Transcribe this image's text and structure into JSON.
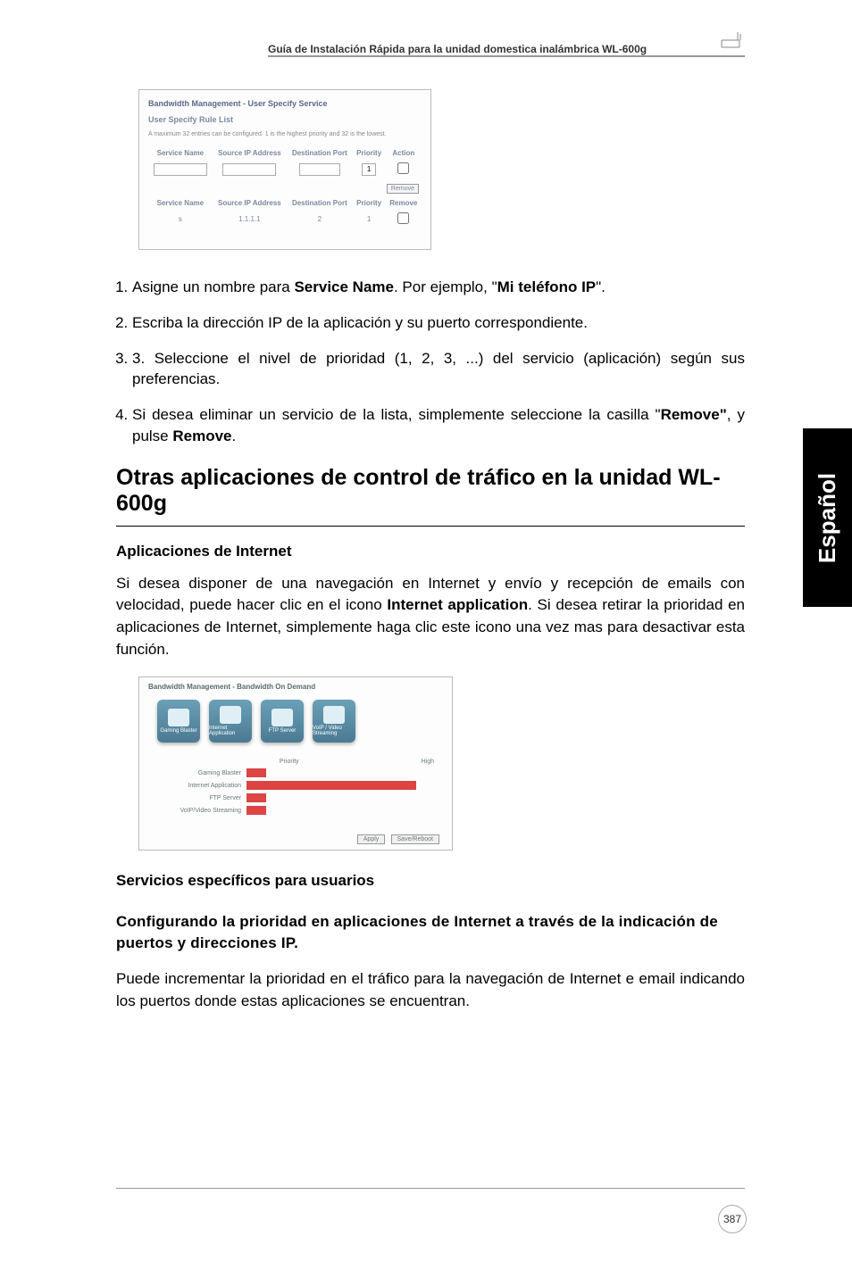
{
  "header": {
    "doc_title": "Guía de Instalación Rápida para la unidad domestica inalámbrica WL-600g"
  },
  "side_tab": "Español",
  "screenshot1": {
    "title": "Bandwidth Management - User Specify Service",
    "subtitle": "User Specify Rule List",
    "note": "A maximum 32 entries can be configured. 1 is the highest priority and 32 is the lowest.",
    "headers": [
      "Service Name",
      "Source IP Address",
      "Destination Port",
      "Priority",
      "Action"
    ],
    "r1_prio": "1",
    "btn_remove": "Remove",
    "r2_sname": "s",
    "r2_sip": "1.1.1.1",
    "r2_port": "2",
    "r2_prio": "1"
  },
  "steps": {
    "s1_a": "Asigne un nombre para ",
    "s1_b": "Service Name",
    "s1_c": ". Por ejemplo, \"",
    "s1_d": "Mi teléfono IP",
    "s1_e": "\".",
    "s2": "Escriba la dirección IP de la aplicación y su puerto correspondiente.",
    "s3": "3. Seleccione el nivel de prioridad (1, 2, 3, ...) del servicio (aplicación) según sus preferencias.",
    "s4_a": "Si desea eliminar un servicio de la lista, simplemente seleccione la casilla \"",
    "s4_b": "Remove\"",
    "s4_c": ", y pulse ",
    "s4_d": "Remove",
    "s4_e": "."
  },
  "section_title": "Otras aplicaciones de control de tráfico en la unidad WL-600g",
  "apps_head": "Aplicaciones de Internet",
  "apps_para_a": "Si desea disponer de una navegación en Internet y envío y recepción de emails con velocidad, puede hacer clic en el icono ",
  "apps_para_b": "Internet application",
  "apps_para_c": ". Si desea retirar la prioridad en aplicaciones de Internet, simplemente haga clic este icono una vez mas para desactivar esta función.",
  "screenshot2": {
    "hdr": "Bandwidth Management - Bandwidth On Demand",
    "ic1": "Gaming Blaster",
    "ic2": "Internet Application",
    "ic3": "FTP Server",
    "ic4": "VoIP / Video Streaming",
    "prio": "Priority",
    "high": "High",
    "row1": "Gaming Blaster",
    "row2": "Internet Application",
    "row3": "FTP Server",
    "row4": "VoIP/Video Streaming",
    "btn_apply": "Apply",
    "btn_save": "Save/Reboot"
  },
  "user_services_head": "Servicios específicos para usuarios",
  "config_head": "Configurando la prioridad en aplicaciones de Internet a través de la indicación de puertos y direcciones IP.",
  "config_para": "Puede incrementar la prioridad en el tráfico para la navegación de Internet e email indicando los puertos donde estas aplicaciones se encuentran.",
  "page_number": "387"
}
